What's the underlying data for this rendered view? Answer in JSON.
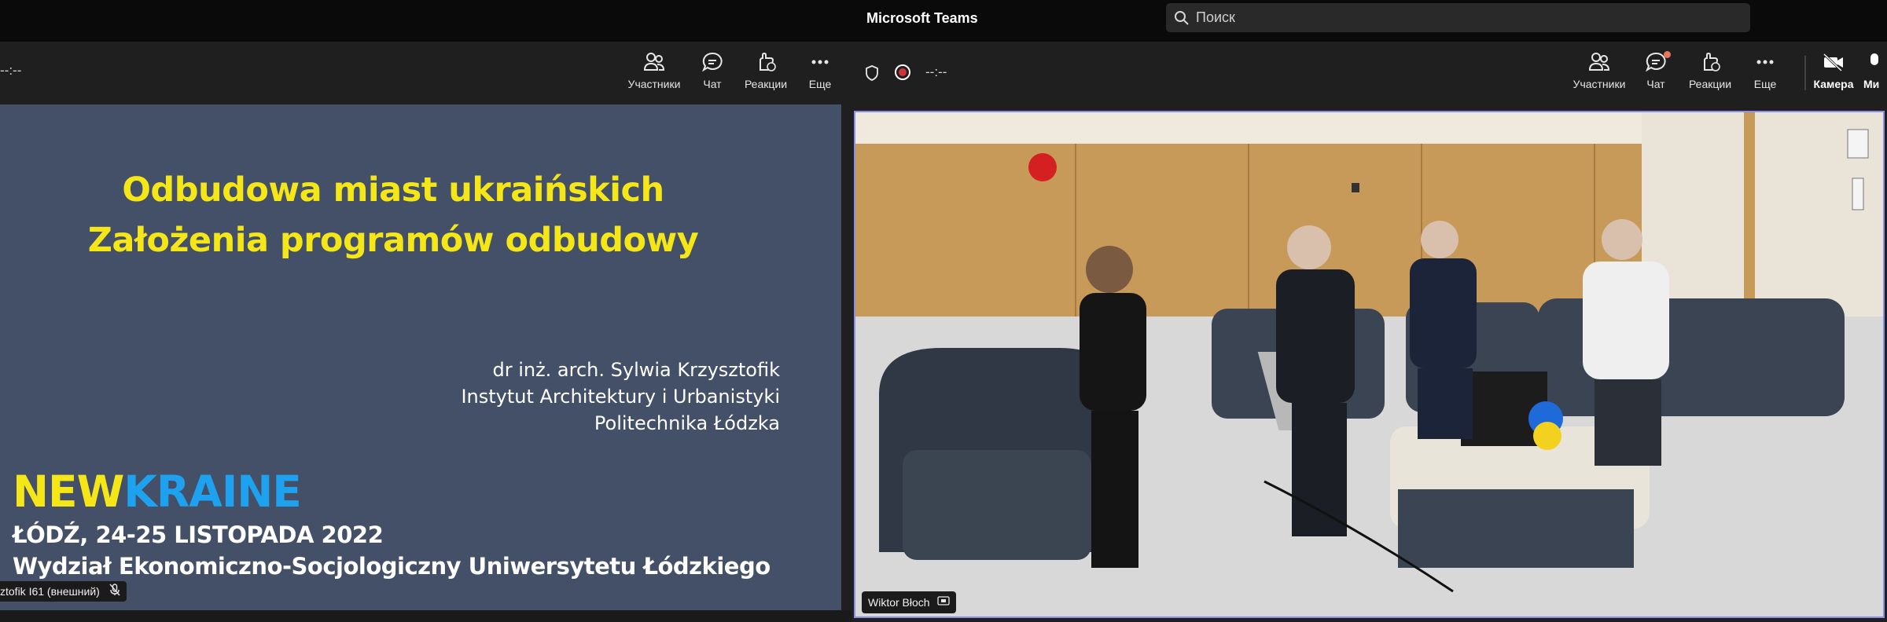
{
  "left_window": {
    "timer": "--:--",
    "toolbar": [
      {
        "label": "Участники",
        "icon": "participants-icon"
      },
      {
        "label": "Чат",
        "icon": "chat-icon"
      },
      {
        "label": "Реакции",
        "icon": "reactions-icon"
      },
      {
        "label": "Еще",
        "icon": "more-icon"
      }
    ],
    "slide": {
      "title_line1": "Odbudowa miast ukraińskich",
      "title_line2": "Założenia programów odbudowy",
      "author_line1": "dr inż. arch. Sylwia Krzysztofik",
      "author_line2": "Instytut Architektury i Urbanistyki",
      "author_line3": "Politechnika Łódzka",
      "logo_part1": "NEW",
      "logo_part2": "KRAINE",
      "event_line1": "ŁÓDŹ, 24-25 LISTOPADA 2022",
      "event_line2": "Wydział Ekonomiczno-Socjologiczny Uniwersytetu Łódzkiego",
      "colors": {
        "background": "#435068",
        "title": "#f5e617",
        "logo_blue": "#1ea1ef"
      }
    },
    "presenter_tag": "ztofik I61 (внешний)"
  },
  "right_window": {
    "app_title": "Microsoft Teams",
    "search": {
      "placeholder": "Поиск"
    },
    "timer": "--:--",
    "toolbar": [
      {
        "label": "Участники",
        "icon": "participants-icon"
      },
      {
        "label": "Чат",
        "icon": "chat-icon",
        "notification": true
      },
      {
        "label": "Реакции",
        "icon": "reactions-icon"
      },
      {
        "label": "Еще",
        "icon": "more-icon"
      },
      {
        "label": "Камера",
        "icon": "camera-off-icon"
      },
      {
        "label": "Ми",
        "icon": "mic-icon"
      }
    ],
    "video": {
      "participant_name": "Wiktor Błoch",
      "frame_color": "#8b8ee8"
    }
  }
}
